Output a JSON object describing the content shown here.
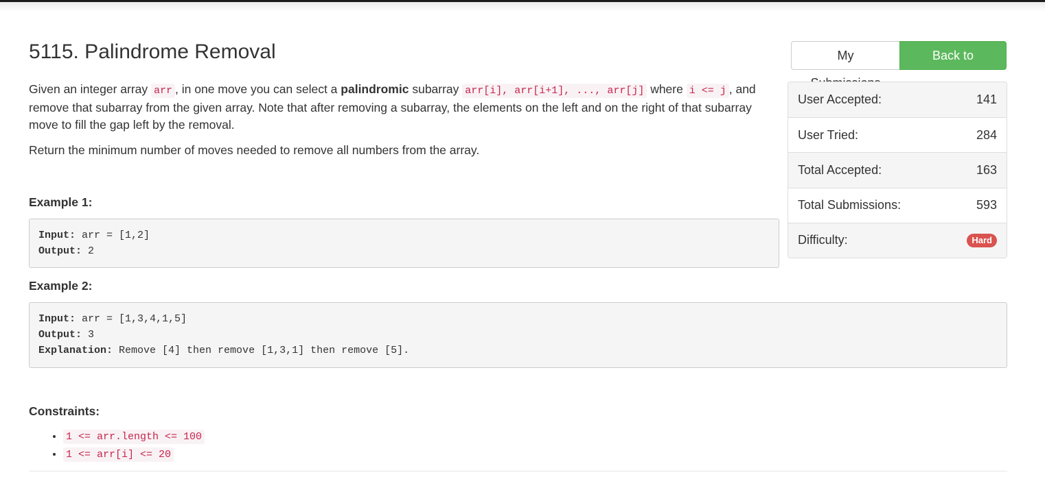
{
  "problem": {
    "title": "5115. Palindrome Removal"
  },
  "actions": {
    "my_submissions": "My Submissions",
    "back_to_contest": "Back to Contest"
  },
  "stats": [
    {
      "label": "User Accepted:",
      "value": "141"
    },
    {
      "label": "User Tried:",
      "value": "284"
    },
    {
      "label": "Total Accepted:",
      "value": "163"
    },
    {
      "label": "Total Submissions:",
      "value": "593"
    },
    {
      "label": "Difficulty:",
      "value": "Hard"
    }
  ],
  "colors": {
    "accent_green": "#5cb85c",
    "hard_badge": "#d9534f",
    "code_text": "#c7254e"
  },
  "description": {
    "p1_part1": "Given an integer array ",
    "p1_code1": "arr",
    "p1_part2": ", in one move you can select a ",
    "p1_bold": "palindromic",
    "p1_part3": " subarray ",
    "p1_code2": "arr[i], arr[i+1], ..., arr[j]",
    "p1_part4": " where ",
    "p1_code3": "i <= j",
    "p1_part5": ", and remove that subarray from the given array. Note that after removing a subarray, the elements on the left and on the right of that subarray move to fill the gap left by the removal.",
    "p2": "Return the minimum number of moves needed to remove all numbers from the array."
  },
  "examples": [
    {
      "heading": "Example 1:",
      "input_label": "Input:",
      "input_value": " arr = [1,2]",
      "output_label": "Output:",
      "output_value": " 2"
    },
    {
      "heading": "Example 2:",
      "input_label": "Input:",
      "input_value": " arr = [1,3,4,1,5]",
      "output_label": "Output:",
      "output_value": " 3",
      "explanation_label": "Explanation:",
      "explanation_value": " Remove [4] then remove [1,3,1] then remove [5]."
    }
  ],
  "constraints": {
    "heading": "Constraints:",
    "items": [
      "1 <= arr.length <= 100",
      "1 <= arr[i] <= 20"
    ]
  }
}
